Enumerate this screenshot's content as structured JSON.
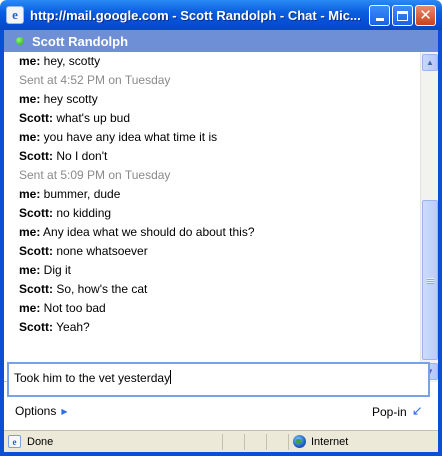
{
  "window": {
    "title": "http://mail.google.com - Scott Randolph - Chat - Mic..."
  },
  "chat": {
    "contact_name": "Scott Randolph",
    "status_color": "#2fb52a",
    "messages": [
      {
        "who": "me:",
        "text": " hey, scotty"
      },
      {
        "time": "Sent at 4:52 PM on Tuesday"
      },
      {
        "who": "me:",
        "text": " hey scotty"
      },
      {
        "who": "Scott:",
        "text": " what's up bud"
      },
      {
        "who": "me:",
        "text": " you have any idea what time it is"
      },
      {
        "who": "Scott:",
        "text": " No I don't"
      },
      {
        "time": "Sent at 5:09 PM on Tuesday"
      },
      {
        "who": "me:",
        "text": " bummer, dude"
      },
      {
        "who": "Scott:",
        "text": " no kidding"
      },
      {
        "who": "me:",
        "text": " Any idea what we should do about this?"
      },
      {
        "who": "Scott:",
        "text": " none whatsoever"
      },
      {
        "who": "me:",
        "text": " Dig it"
      },
      {
        "who": "Scott:",
        "text": " So, how's the cat"
      },
      {
        "who": "me:",
        "text": " Not too bad"
      },
      {
        "who": "Scott:",
        "text": " Yeah?"
      }
    ],
    "input_value": "Took him to the vet yesterday"
  },
  "footer": {
    "options_label": "Options",
    "popin_label": "Pop-in"
  },
  "statusbar": {
    "done_label": "Done",
    "zone_label": "Internet"
  },
  "icons": {
    "app": "ie-icon",
    "status": "status-dot",
    "options": "arrow-right-icon",
    "popin": "pop-in-arrow-icon",
    "zone": "globe-icon"
  }
}
